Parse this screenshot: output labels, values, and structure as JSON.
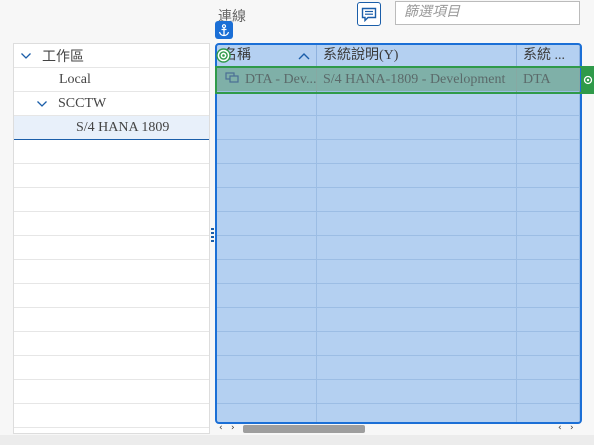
{
  "connection": {
    "label": "連線",
    "filter_placeholder": "篩選項目"
  },
  "tree": {
    "items": [
      {
        "label": "工作區",
        "level": 0,
        "expanded": true,
        "selected": false
      },
      {
        "label": "Local",
        "level": 1,
        "expanded": false,
        "selected": false
      },
      {
        "label": "SCCTW",
        "level": 1,
        "expanded": true,
        "selected": false
      },
      {
        "label": "S/4 HANA 1809",
        "level": 2,
        "expanded": false,
        "selected": true
      }
    ]
  },
  "grid": {
    "columns": [
      {
        "label": "名稱",
        "sort": "ascending"
      },
      {
        "label": "系統說明(Y)"
      },
      {
        "label": "系統 ..."
      }
    ],
    "rows": [
      {
        "name": "DTA - Dev...",
        "description": "S/4 HANA-1809 - Development",
        "system": "DTA"
      }
    ]
  },
  "icons": {
    "comment": "comment-icon",
    "anchor": "anchor-icon",
    "target": "target-icon",
    "system": "system-icon",
    "chevron": "chevron-down-icon"
  },
  "colors": {
    "accent": "#1b6fd6",
    "selection_fill": "#b4d0f1",
    "row_highlight": "#2f9a4a"
  }
}
